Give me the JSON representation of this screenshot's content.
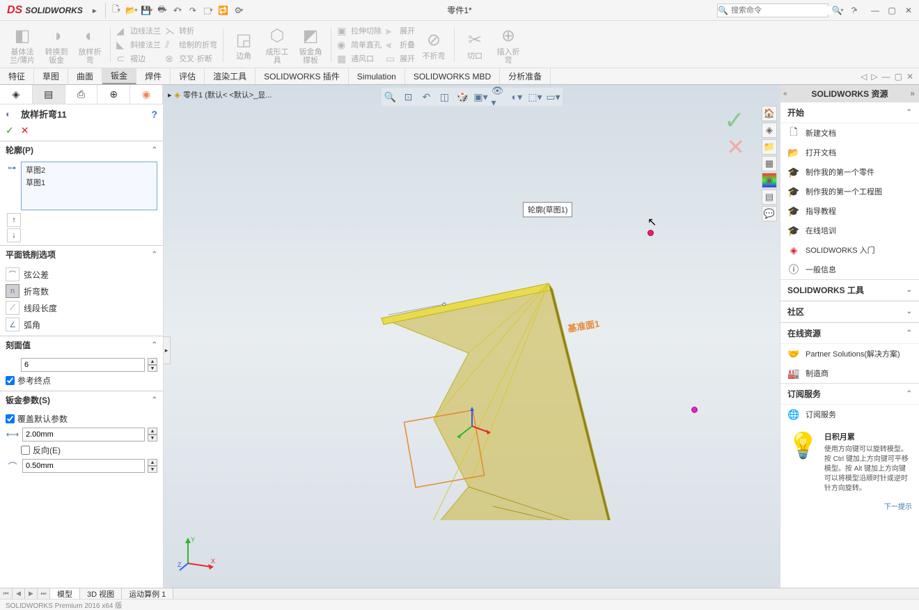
{
  "app": {
    "name": "SOLIDWORKS",
    "doc_title": "零件1*"
  },
  "search": {
    "placeholder": "搜索命令"
  },
  "ribbon": {
    "groups": [
      {
        "label": "基体法\n兰/薄片"
      },
      {
        "label": "转换到\n钣金"
      },
      {
        "label": "放样折\n弯"
      }
    ],
    "col1": [
      "边线法兰",
      "斜接法兰",
      "褶边"
    ],
    "col2": [
      "转折",
      "绘制的折弯",
      "交叉·折断"
    ],
    "g_mid": [
      "边角",
      "成形工\n具",
      "钣金角\n撑板"
    ],
    "col3": [
      "拉伸切除",
      "简单直孔",
      "通风口"
    ],
    "col4": [
      "展开",
      "折叠",
      "展开"
    ],
    "g_right": [
      "不折弯",
      "切口",
      "插入折\n弯"
    ]
  },
  "tabs": [
    "特征",
    "草图",
    "曲面",
    "钣金",
    "焊件",
    "评估",
    "渲染工具",
    "SOLIDWORKS 插件",
    "Simulation",
    "SOLIDWORKS MBD",
    "分析准备"
  ],
  "active_tab": 3,
  "breadcrumb": "零件1  (默认< <默认>_显...",
  "feature": {
    "name": "放样折弯11",
    "sections": {
      "profile": {
        "title": "轮廓(P)",
        "items": [
          "草图2",
          "草图1"
        ]
      },
      "milling": {
        "title": "平面铣削选项",
        "options": [
          "弦公差",
          "折弯数",
          "线段长度",
          "弧角"
        ],
        "active": 1
      },
      "facet": {
        "title": "刻面值",
        "value": "6",
        "ref_endpoint": "参考终点"
      },
      "sheetmetal": {
        "title": "钣金参数(S)",
        "override": "覆盖默认参数",
        "thickness": "2.00mm",
        "reverse": "反向(E)",
        "radius": "0.50mm"
      }
    }
  },
  "viewport": {
    "profile_label": "轮廓(草图1)",
    "datum_label": "基准面1"
  },
  "right_panel": {
    "title": "SOLIDWORKS 资源",
    "sections": {
      "start": {
        "title": "开始",
        "items": [
          "新建文档",
          "打开文档",
          "制作我的第一个零件",
          "制作我的第一个工程图",
          "指导教程",
          "在线培训",
          "SOLIDWORKS 入门",
          "一般信息"
        ]
      },
      "tools": {
        "title": "SOLIDWORKS 工具"
      },
      "community": {
        "title": "社区"
      },
      "online": {
        "title": "在线资源",
        "items": [
          "Partner Solutions(解决方案)",
          "制造商"
        ]
      },
      "subscription": {
        "title": "订阅服务",
        "items": [
          "订阅服务"
        ]
      }
    },
    "tip": {
      "title": "日积月累",
      "text": "使用方向键可以旋转模型。按 Ctrl 键加上方向键可平移模型。按 Alt 键加上方向键可以将模型沿顺时针或逆时针方向旋转。",
      "next": "下一提示"
    }
  },
  "bottom_tabs": [
    "模型",
    "3D 视图",
    "运动算例 1"
  ],
  "status": "SOLIDWORKS Premium 2016 x64 版"
}
